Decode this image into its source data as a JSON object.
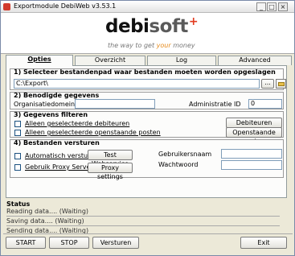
{
  "window": {
    "title": "Exportmodule DebiWeb v3.53.1",
    "controls": {
      "minimize": "_",
      "maximize": "□",
      "close": "×"
    }
  },
  "banner": {
    "logo_debi": "debi",
    "logo_soft": "soft",
    "logo_plus": "+",
    "tagline_start": "the way to get ",
    "tagline_your": "your",
    "tagline_money": " money",
    "accent_color": "#e23b1f"
  },
  "tabs": [
    "Opties",
    "Overzicht",
    "Log",
    "Advanced"
  ],
  "section1": {
    "title": "1) Selecteer bestandenpad waar bestanden moeten worden opgeslagen",
    "path_value": "C:\\Export\\",
    "browse_label": "...",
    "folder_icon": "folder-open-icon"
  },
  "section2": {
    "title": "2) Benodigde gegevens",
    "org_label": "Organisatiedomein",
    "org_value": "",
    "admin_label": "Administratie ID",
    "admin_value": "0"
  },
  "section3": {
    "title": "3) Gegevens filteren",
    "chk1_label": "Alleen geselecteerde debiteuren",
    "chk2_label": "Alleen geselecteerde openstaande posten",
    "btn_debiteuren": "Debiteuren",
    "btn_posten": "Openstaande posten"
  },
  "section4": {
    "title": "4) Bestanden versturen",
    "chk1_label": "Automatisch versturen",
    "chk2_label": "Gebruik Proxy Server",
    "btn_test": "Test Webservice",
    "btn_proxy": "Proxy settings",
    "user_label": "Gebruikersnaam",
    "user_value": "",
    "pass_label": "Wachtwoord",
    "pass_value": ""
  },
  "status": {
    "title": "Status",
    "reading": "Reading data....   (Waiting)",
    "saving": "Saving data....   (Waiting)",
    "sending": "Sending data....   (Waiting)"
  },
  "footer": {
    "start": "START",
    "stop": "STOP",
    "versturen": "Versturen",
    "exit": "Exit"
  }
}
